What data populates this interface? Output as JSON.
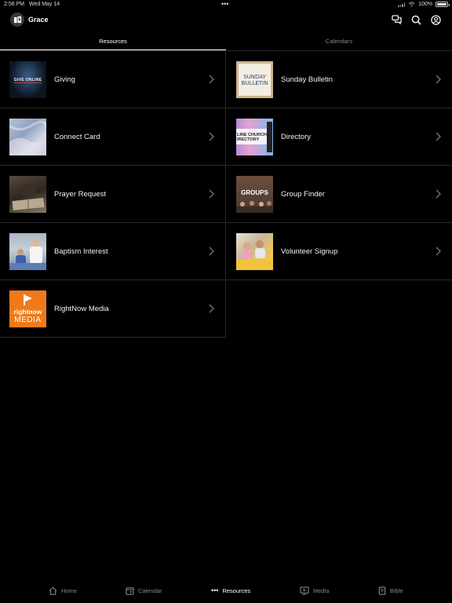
{
  "status": {
    "time": "2:56 PM",
    "date": "Wed May 14",
    "battery": "100%",
    "battery_level": 1.0
  },
  "header": {
    "title": "Grace"
  },
  "tabs": [
    {
      "label": "Resources",
      "active": true
    },
    {
      "label": "Calendars",
      "active": false
    }
  ],
  "resources_left": [
    {
      "label": "Giving",
      "thumb_text": "GIVE ONLINE",
      "icon": "giving-thumbnail"
    },
    {
      "label": "Connect Card",
      "icon": "connect-card-thumbnail"
    },
    {
      "label": "Prayer Request",
      "icon": "prayer-request-thumbnail"
    },
    {
      "label": "Baptism Interest",
      "icon": "baptism-thumbnail"
    },
    {
      "label": "RightNow Media",
      "thumb_text_top": "rightnow",
      "thumb_text_bottom": "MEDIA",
      "icon": "rightnow-media-logo"
    }
  ],
  "resources_right": [
    {
      "label": "Sunday Bulletin",
      "thumb_text_1": "SUNDAY",
      "thumb_text_2": "BULLETIN",
      "icon": "sunday-bulletin-thumbnail"
    },
    {
      "label": "Directory",
      "thumb_text_1": "LINE CHURCH",
      "thumb_text_2": "IRECTORY",
      "icon": "directory-thumbnail"
    },
    {
      "label": "Group Finder",
      "thumb_text": "GROUPS",
      "icon": "group-finder-thumbnail"
    },
    {
      "label": "Volunteer Signup",
      "icon": "volunteer-thumbnail"
    }
  ],
  "bottom_nav": [
    {
      "label": "Home",
      "icon": "home-icon",
      "active": false
    },
    {
      "label": "Calendar",
      "icon": "calendar-icon",
      "active": false
    },
    {
      "label": "Resources",
      "icon": "more-dots-icon",
      "active": true
    },
    {
      "label": "Media",
      "icon": "media-icon",
      "active": false
    },
    {
      "label": "Bible",
      "icon": "bible-icon",
      "active": false
    }
  ],
  "colors": {
    "background": "#000000",
    "divider": "#2a2a2a",
    "inactive": "#888888",
    "active": "#ffffff"
  }
}
